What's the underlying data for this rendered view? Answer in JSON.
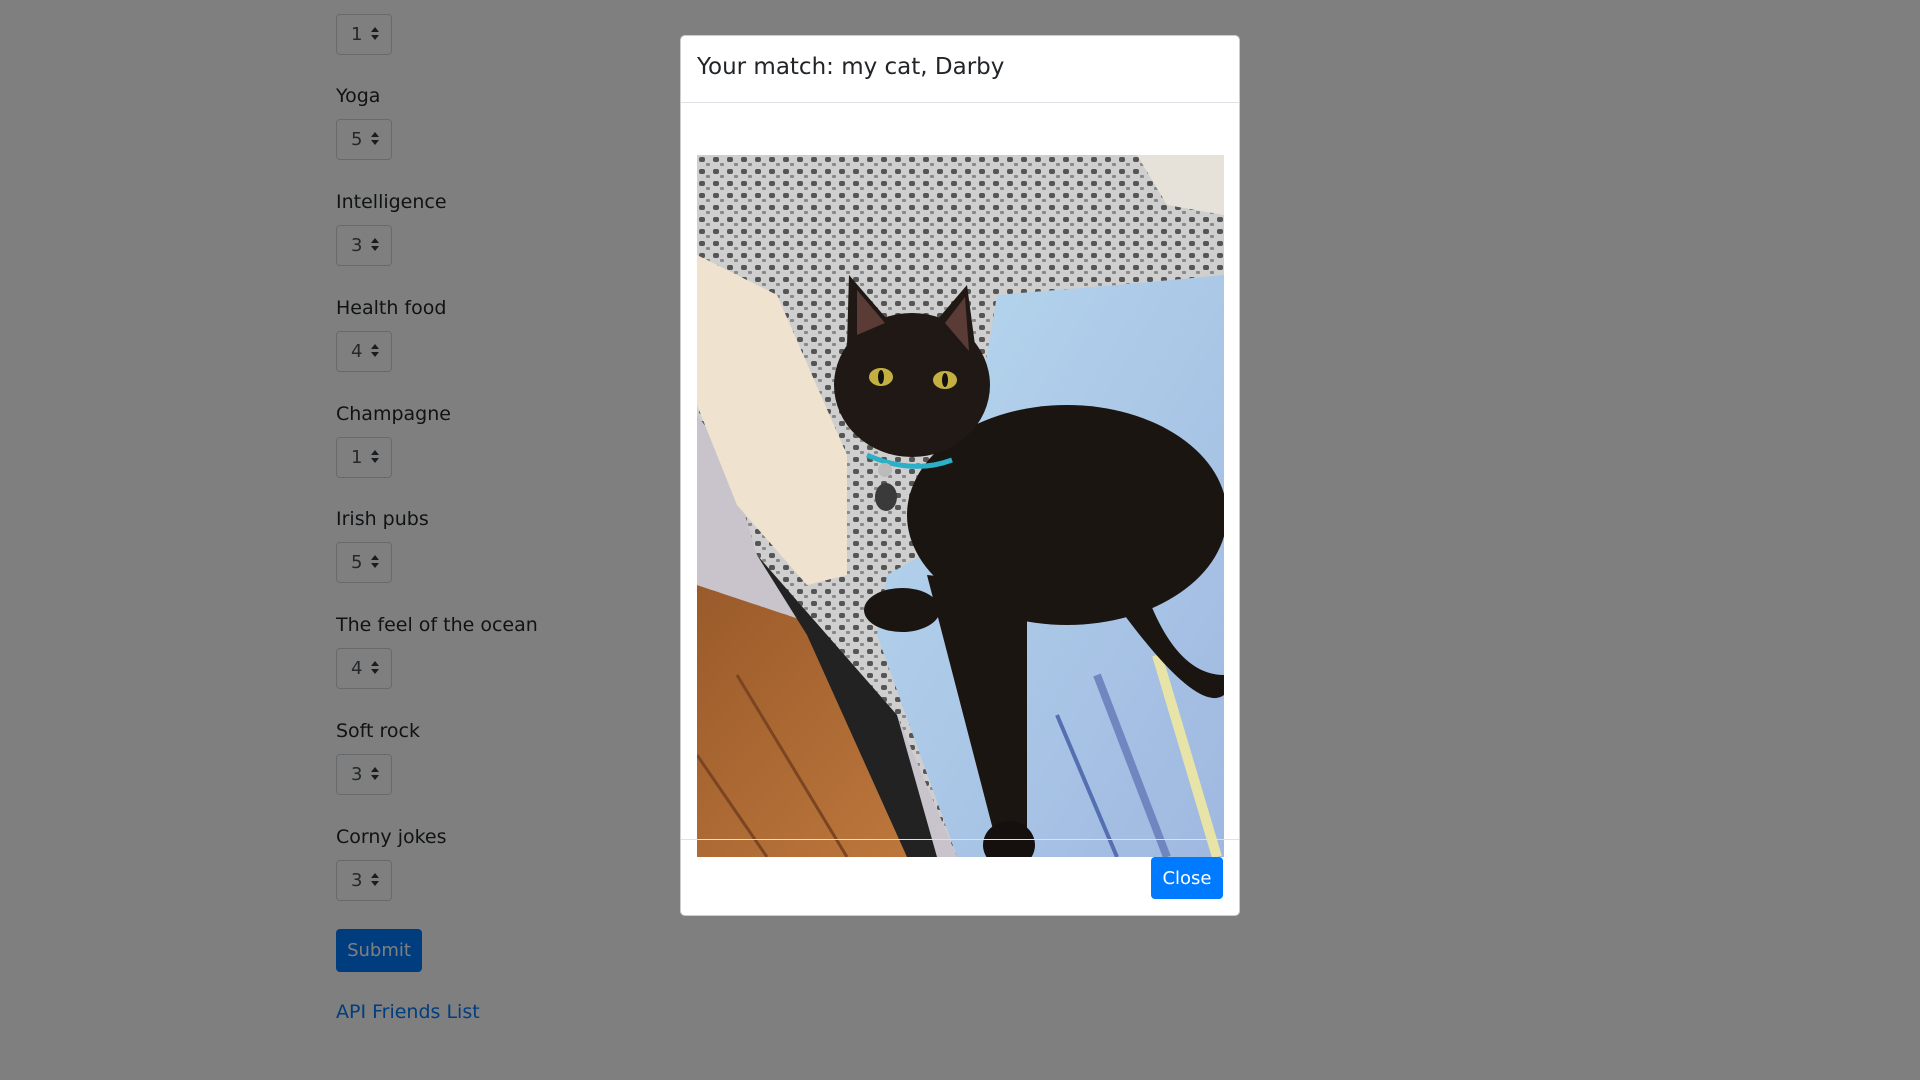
{
  "questions": [
    {
      "label": "",
      "value": "1"
    },
    {
      "label": "Yoga",
      "value": "5"
    },
    {
      "label": "Intelligence",
      "value": "3"
    },
    {
      "label": "Health food",
      "value": "4"
    },
    {
      "label": "Champagne",
      "value": "1"
    },
    {
      "label": "Irish pubs",
      "value": "5"
    },
    {
      "label": "The feel of the ocean",
      "value": "4"
    },
    {
      "label": "Soft rock",
      "value": "3"
    },
    {
      "label": "Corny jokes",
      "value": "3"
    }
  ],
  "form": {
    "submit_label": "Submit",
    "api_link": "API Friends List"
  },
  "modal": {
    "title": "Your match: my cat, Darby",
    "close_label": "Close"
  },
  "icons": {
    "select_arrows": "sort-arrows-icon",
    "photo": "cat-photo"
  },
  "colors": {
    "primary": "#007bff",
    "backdrop": "rgba(0,0,0,0.5)"
  }
}
